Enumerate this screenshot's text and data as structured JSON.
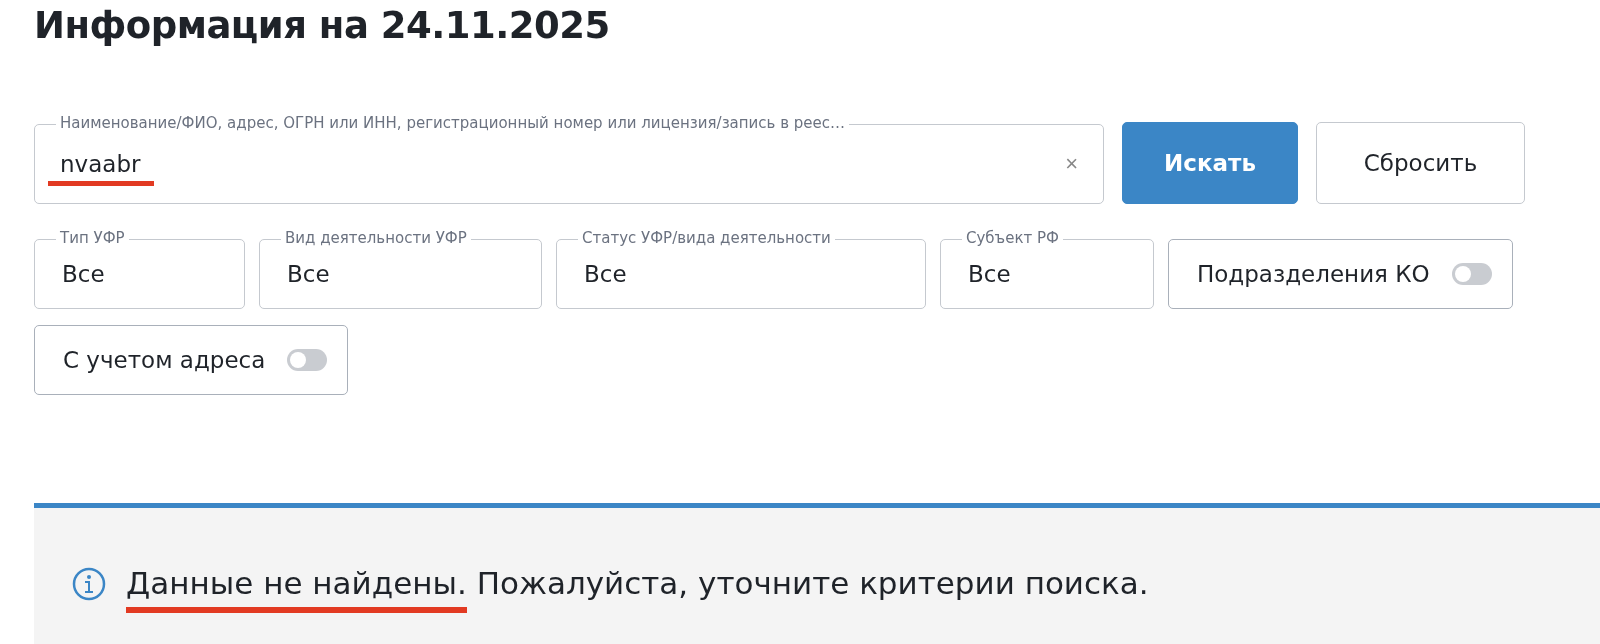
{
  "title": "Информация на 24.11.2025",
  "search": {
    "label": "Наименование/ФИО, адрес, ОГРН или ИНН, регистрационный номер или лицензия/запись в реес…",
    "value": "nvaabr",
    "clear": "×",
    "underlined": true
  },
  "buttons": [
    {
      "label": "Искать",
      "kind": "primary"
    },
    {
      "label": "Сбросить",
      "kind": "secondary"
    }
  ],
  "filters": [
    {
      "kind": "select",
      "label": "Тип УФР",
      "value": "Все"
    },
    {
      "kind": "select",
      "label": "Вид деятельности УФР",
      "value": "Все"
    },
    {
      "kind": "select",
      "label": "Статус УФР/вида деятельности",
      "value": "Все"
    },
    {
      "kind": "select",
      "label": "Субъект РФ",
      "value": "Все"
    },
    {
      "kind": "toggle",
      "label": "Подразделения КО",
      "on": false
    },
    {
      "kind": "toggle",
      "label": "С учетом адреса",
      "on": false
    }
  ],
  "message": {
    "lead": "Данные не найдены.",
    "text": "Пожалуйста, уточните критерии поиска.",
    "lead_underlined": true
  }
}
